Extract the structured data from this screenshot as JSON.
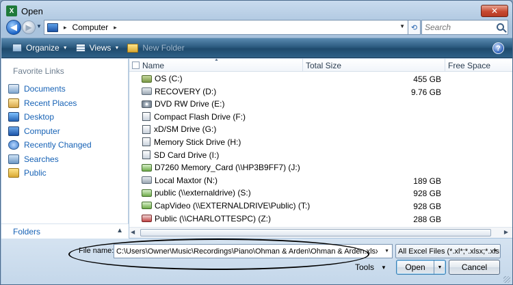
{
  "window": {
    "title": "Open",
    "app_icon_glyph": "X",
    "close_glyph": "✕"
  },
  "address": {
    "crumb": "Computer",
    "separator": "▸",
    "search_placeholder": "Search"
  },
  "toolbar": {
    "organize": "Organize",
    "views": "Views",
    "new_folder": "New Folder",
    "help_glyph": "?"
  },
  "nav": {
    "heading": "Favorite Links",
    "items": [
      {
        "label": "Documents",
        "icon": "documents-icon"
      },
      {
        "label": "Recent Places",
        "icon": "recent-places-icon"
      },
      {
        "label": "Desktop",
        "icon": "desktop-icon"
      },
      {
        "label": "Computer",
        "icon": "computer-icon"
      },
      {
        "label": "Recently Changed",
        "icon": "recently-changed-icon"
      },
      {
        "label": "Searches",
        "icon": "searches-icon"
      },
      {
        "label": "Public",
        "icon": "public-folder-icon"
      }
    ],
    "folders": "Folders"
  },
  "columns": {
    "name": "Name",
    "total_size": "Total Size",
    "free_space": "Free Space"
  },
  "drives": [
    {
      "name": "OS (C:)",
      "size": "455 GB",
      "free": "",
      "icon": "os"
    },
    {
      "name": "RECOVERY (D:)",
      "size": "9.76 GB",
      "free": "",
      "icon": "hdd"
    },
    {
      "name": "DVD RW Drive (E:)",
      "size": "",
      "free": "",
      "icon": "dvd"
    },
    {
      "name": "Compact Flash Drive (F:)",
      "size": "",
      "free": "",
      "icon": "card"
    },
    {
      "name": "xD/SM Drive (G:)",
      "size": "",
      "free": "",
      "icon": "card"
    },
    {
      "name": "Memory Stick Drive (H:)",
      "size": "",
      "free": "",
      "icon": "card"
    },
    {
      "name": "SD Card Drive (I:)",
      "size": "",
      "free": "",
      "icon": "card"
    },
    {
      "name": "D7260 Memory_Card (\\\\HP3B9FF7) (J:)",
      "size": "",
      "free": "",
      "icon": "net"
    },
    {
      "name": "Local Maxtor (N:)",
      "size": "189 GB",
      "free": "",
      "icon": "hdd"
    },
    {
      "name": "public (\\\\externaldrive) (S:)",
      "size": "928 GB",
      "free": "",
      "icon": "net"
    },
    {
      "name": "CapVideo (\\\\EXTERNALDRIVE\\Public) (T:)",
      "size": "928 GB",
      "free": "",
      "icon": "net"
    },
    {
      "name": "Public (\\\\CHARLOTTESPC) (Z:)",
      "size": "288 GB",
      "free": "",
      "icon": "netx"
    }
  ],
  "bottom": {
    "file_name_label": "File name:",
    "file_name_value": "C:\\Users\\Owner\\Music\\Recordings\\Piano\\Ohman & Arden\\Ohman & Arden.xlsx",
    "file_type": "All Excel Files (*.xl*;*.xlsx;*.xlsı",
    "tools": "Tools",
    "open": "Open",
    "cancel": "Cancel"
  }
}
